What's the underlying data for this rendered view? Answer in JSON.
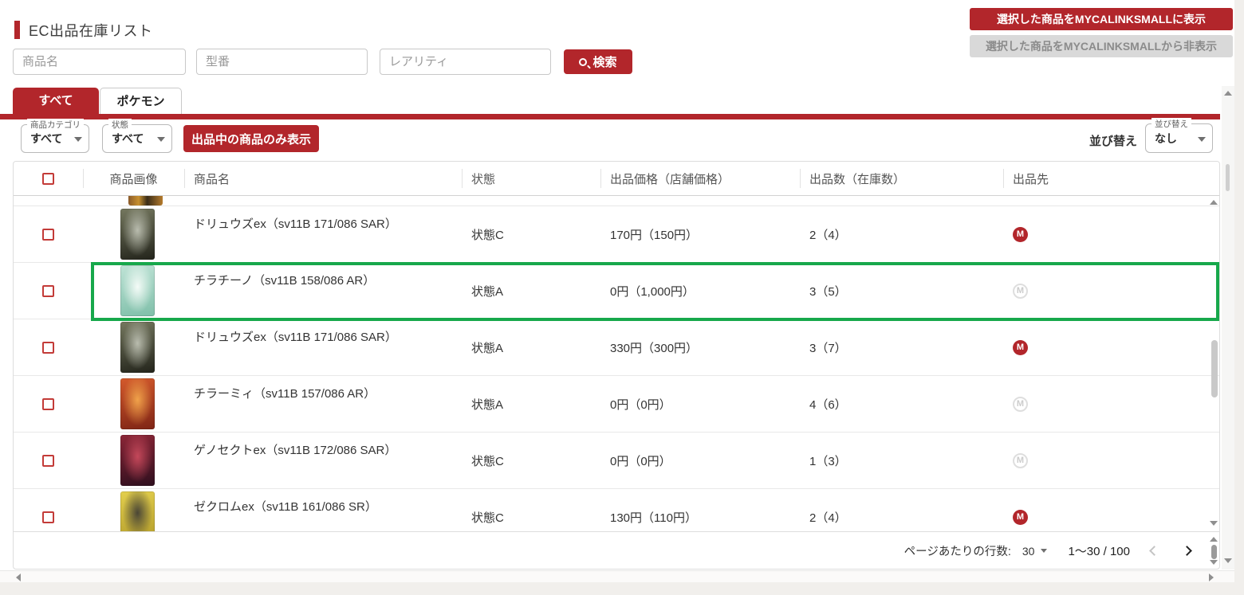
{
  "page": {
    "title": "EC出品在庫リスト"
  },
  "header_actions": {
    "show_button": "選択した商品をMYCALINKSMALLに表示",
    "hide_button": "選択した商品をMYCALINKSMALLから非表示"
  },
  "search": {
    "product_name_placeholder": "商品名",
    "model_number_placeholder": "型番",
    "rarity_placeholder": "レアリティ",
    "search_button": "検索"
  },
  "tabs": [
    {
      "label": "すべて",
      "active": true
    },
    {
      "label": "ポケモン",
      "active": false
    }
  ],
  "filters": {
    "category": {
      "label": "商品カテゴリ",
      "value": "すべて"
    },
    "condition": {
      "label": "状態",
      "value": "すべて"
    },
    "listed_only_button": "出品中の商品のみ表示",
    "sort_outer_label": "並び替え",
    "sort": {
      "label": "並び替え",
      "value": "なし"
    }
  },
  "table": {
    "columns": [
      "商品画像",
      "商品名",
      "状態",
      "出品価格（店舗価格）",
      "出品数（在庫数）",
      "出品先"
    ],
    "destination_icon_letter": "M",
    "rows": [
      {
        "name": "ドリュウズex（sv11B 171/086 SAR）",
        "condition": "状態C",
        "price": "170円（150円）",
        "count": "2（4）",
        "destination_active": true,
        "highlighted": false,
        "image_colors": [
          "#75785f",
          "#23241b",
          "#b9bcae"
        ]
      },
      {
        "name": "チラチーノ（sv11B 158/086 AR）",
        "condition": "状態A",
        "price": "0円（1,000円）",
        "count": "3（5）",
        "destination_active": false,
        "highlighted": true,
        "image_colors": [
          "#bfe3d6",
          "#7fbfa9",
          "#f4fbf7"
        ]
      },
      {
        "name": "ドリュウズex（sv11B 171/086 SAR）",
        "condition": "状態A",
        "price": "330円（300円）",
        "count": "3（7）",
        "destination_active": true,
        "highlighted": false,
        "image_colors": [
          "#75785f",
          "#23241b",
          "#b9bcae"
        ]
      },
      {
        "name": "チラーミィ（sv11B 157/086 AR）",
        "condition": "状態A",
        "price": "0円（0円）",
        "count": "4（6）",
        "destination_active": false,
        "highlighted": false,
        "image_colors": [
          "#d45a2c",
          "#7e2415",
          "#f0a24a"
        ]
      },
      {
        "name": "ゲノセクトex（sv11B 172/086 SAR）",
        "condition": "状態C",
        "price": "0円（0円）",
        "count": "1（3）",
        "destination_active": false,
        "highlighted": false,
        "image_colors": [
          "#8c2637",
          "#2e0f1e",
          "#c4485a"
        ]
      },
      {
        "name": "ゼクロムex（sv11B 161/086 SR）",
        "condition": "状態C",
        "price": "130円（110円）",
        "count": "2（4）",
        "destination_active": true,
        "highlighted": false,
        "image_colors": [
          "#e3cf4e",
          "#b19a28",
          "#4a4636"
        ]
      }
    ]
  },
  "pagination": {
    "rows_per_page_label": "ページあたりの行数:",
    "rows_per_page_value": "30",
    "range_text": "1〜30 / 100"
  },
  "icons": {
    "search": "magnifier",
    "select_caret": "caret-down",
    "prev_page": "chevron-left",
    "next_page": "chevron-right",
    "destination": "mycalinks-mall-circle-m",
    "scroll": "triangle-arrows"
  },
  "colors": {
    "accent_red": "#b2262b",
    "highlight_green": "#17a84b",
    "disabled_gray": "#d9d9d9"
  }
}
